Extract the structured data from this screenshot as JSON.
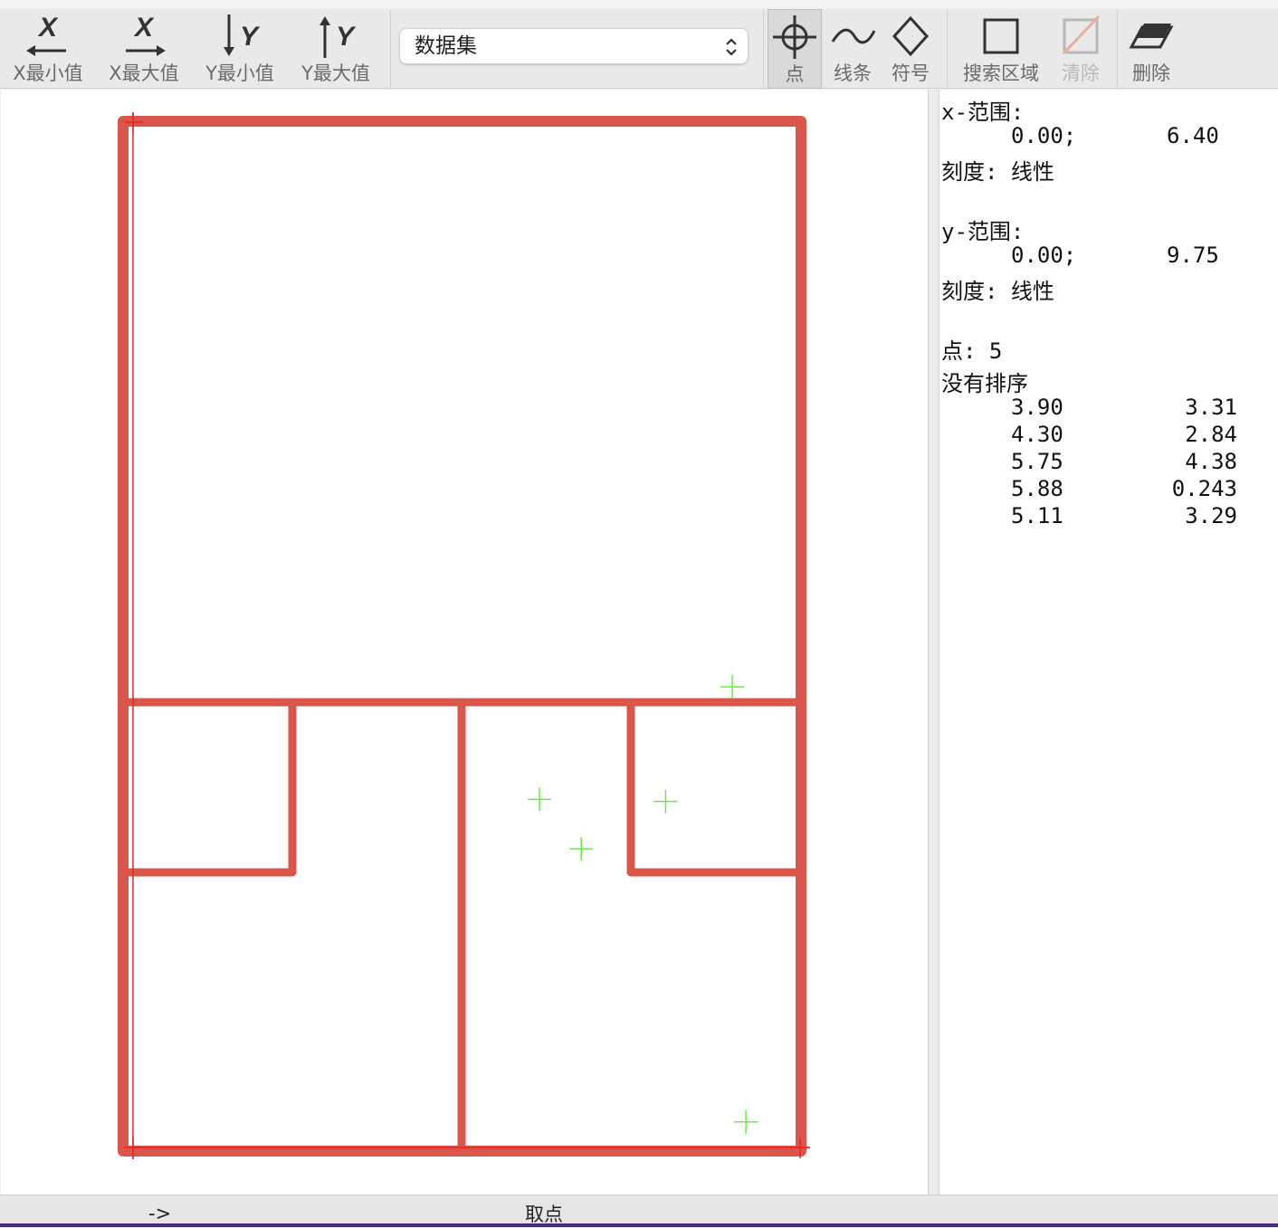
{
  "toolbar": {
    "x_min": "X最小值",
    "x_max": "X最大值",
    "y_min": "Y最小值",
    "y_max": "Y最大值",
    "dataset_select": "数据集",
    "point": "点",
    "line": "线条",
    "symbol": "符号",
    "search_region": "搜索区域",
    "clear": "清除",
    "delete": "删除"
  },
  "info": {
    "x_range_label": "x-范围:",
    "x_min": "0.00;",
    "x_max": "6.40",
    "x_scale": "刻度: 线性",
    "y_range_label": "y-范围:",
    "y_min": "0.00;",
    "y_max": "9.75",
    "y_scale": "刻度: 线性",
    "points_label": "点: 5",
    "sort_label": "没有排序",
    "points": [
      {
        "x": "3.90",
        "y": "3.31"
      },
      {
        "x": "4.30",
        "y": "2.84"
      },
      {
        "x": "5.75",
        "y": "4.38"
      },
      {
        "x": "5.88",
        "y": "0.243"
      },
      {
        "x": "5.11",
        "y": "3.29"
      }
    ]
  },
  "status": {
    "arrow": "->",
    "mode": "取点"
  },
  "colors": {
    "plan_line": "#d9574a",
    "marker": "#66ee44",
    "axis_marker": "#ee2222"
  }
}
